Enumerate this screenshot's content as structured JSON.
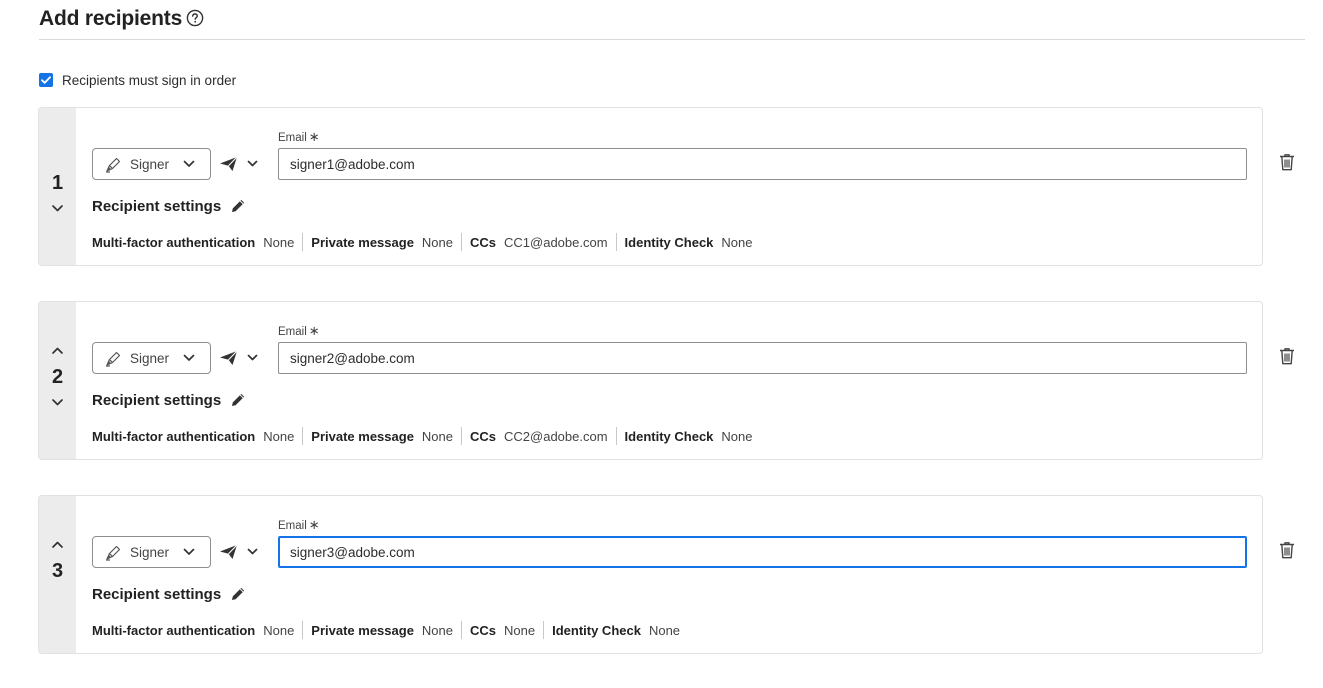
{
  "header": {
    "title": "Add recipients",
    "help_icon": "help-circle-icon"
  },
  "order_option": {
    "label": "Recipients must sign in order",
    "checked": true
  },
  "labels": {
    "email": "Email",
    "required_mark": "∗",
    "recipient_settings": "Recipient settings",
    "mfa": "Multi-factor authentication",
    "private_message": "Private message",
    "ccs": "CCs",
    "identity_check": "Identity Check"
  },
  "colors": {
    "accent": "#1473e6",
    "order_panel": "#ececec"
  },
  "recipients": [
    {
      "order": "1",
      "role": "Signer",
      "email": "signer1@adobe.com",
      "focused": false,
      "mfa": "None",
      "private_message": "None",
      "ccs": "CC1@adobe.com",
      "identity_check": "None"
    },
    {
      "order": "2",
      "role": "Signer",
      "email": "signer2@adobe.com",
      "focused": false,
      "mfa": "None",
      "private_message": "None",
      "ccs": "CC2@adobe.com",
      "identity_check": "None"
    },
    {
      "order": "3",
      "role": "Signer",
      "email": "signer3@adobe.com",
      "focused": true,
      "mfa": "None",
      "private_message": "None",
      "ccs": "None",
      "identity_check": "None"
    }
  ]
}
